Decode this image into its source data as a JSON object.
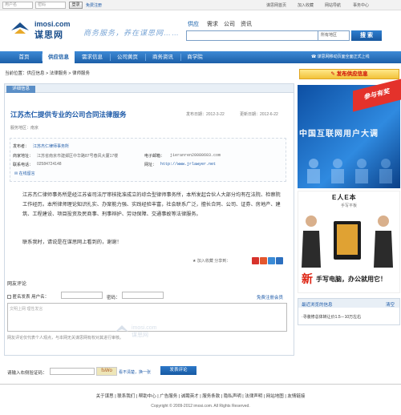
{
  "topbar": {
    "user_placeholder": "用户名",
    "pass_placeholder": "密码",
    "login_label": "登录",
    "register_label": "免费注册",
    "links": [
      "谋思网首页",
      "加入收藏",
      "网站导航",
      "事务中心"
    ]
  },
  "header": {
    "logo_en": "imosi.com",
    "logo_cn": "谋思网",
    "slogan": "商务服务，养在谋思网……",
    "search_tabs": [
      "供应",
      "需求",
      "公司",
      "资讯"
    ],
    "search_value": "",
    "search_select": "所有地区",
    "search_button": "搜 索"
  },
  "nav": {
    "items": [
      "首页",
      "供应信息",
      "需求信息",
      "公司黄页",
      "商务资讯",
      "商学院"
    ],
    "notice": "谋思网移动页面全面正式上线"
  },
  "breadcrumb": "当前位置：供应信息 > 法律服务 > 律师服务",
  "panel": {
    "tab": "详细信息",
    "title": "江苏杰仁提供专业的公司合同法律服务",
    "publish_date": "发布日期：2012-3-22",
    "update_date": "更新日期：2012-6-22",
    "area": "服务地区：南京",
    "publisher_label": "发布者：",
    "publisher_value": "江苏杰仁律师事务所",
    "address_label": "商家地址：",
    "address_value": "江苏省南京市建邺区中华路87号春风大厦17楼",
    "email_label": "电子邮箱：",
    "email_value": "jieranren20080603.com",
    "phone_label": "联系电话：",
    "phone_value": "02584724148",
    "website_label": "网址：",
    "website_value": "http://www.jrlawyer.net",
    "online_msg": "在线留言",
    "body": "江苏杰仁律师事务所是经江苏省司法厅审核批准成立的综合型律师事务所，本所发起合伙人大部分均有在法院、检察院工作经历。本所律师理论知识扎实、办案能力强、实践经验丰富，社会联系广泛，擅长合同、公司、证券、房地产、建筑、工程建设、项目投资及民商事、刑事辩护、劳动保障、交通事故等法律服务。",
    "contact_note": "联系我时，请说是在谋思网上看到的，谢谢！",
    "favorite": "加入收藏",
    "share": "分享到："
  },
  "comments": {
    "title": "网友评论",
    "anonymous": "匿名发表",
    "username_label": "用户名：",
    "password_label": "密码：",
    "register_link": "免费注册会员",
    "placeholder": "文明上网 理性发言",
    "note": "网友评论仅代表个人观点，与本网无关谋思网有权对其进行审核。",
    "vcode_label": "请输入右侧验证码：",
    "vcode_image": "fsWo",
    "vcode_change": "看不清楚，换一张",
    "submit": "发表评论"
  },
  "sidebar": {
    "publish_button": "发布供应信息",
    "ad1_tag": "参与有奖",
    "ad1_text": "中国互联网用户大调",
    "ad2_brand": "E人E本",
    "ad2_tab": "手写平板",
    "ad2_new": "新",
    "ad2_slogan": "手写电脑，办公就用它！",
    "recent_title": "最近浏览的信息",
    "recent_clear": "清空",
    "recent_items": [
      "·寻装修总体转让价1.5－10万左右"
    ]
  },
  "footer": {
    "links": [
      "关于谋思",
      "联系我们",
      "帮助中心",
      "广告服务",
      "诚聘英才",
      "服务条款",
      "隐私声明",
      "法律声明",
      "网站地图",
      "友情链接"
    ],
    "copyright": "Copyright © 2009-2012 imosi.com. All Rights Reserved."
  },
  "colors": {
    "nav_blue": "#1c5fa8",
    "title_blue": "#1d5aa8",
    "ad_red": "#e4322b"
  }
}
